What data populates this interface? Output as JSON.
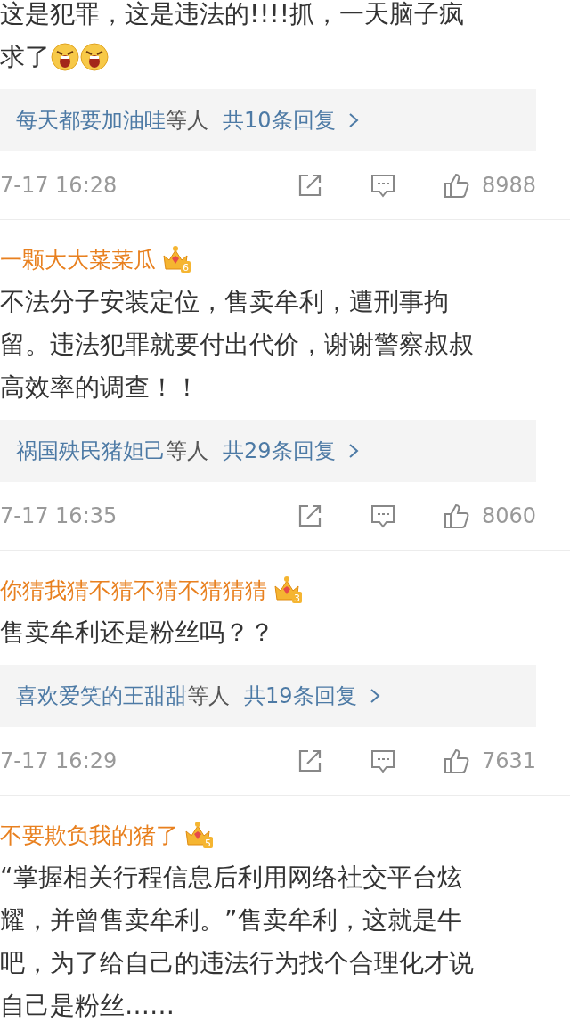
{
  "comments": [
    {
      "body_lines": [
        "这是犯罪，这是违法的!!!!抓，一天脑子疯",
        "求了"
      ],
      "emojis": [
        {
          "kind": "angry"
        },
        {
          "kind": "angry"
        }
      ],
      "reply_preview": {
        "names": "每天都要加油哇",
        "suffix": "等人",
        "count": "共10条回复"
      },
      "time": "7-17 16:28",
      "likes": "8988"
    },
    {
      "username": "一颗大大菜菜瓜",
      "badge_level": "6",
      "body_lines": [
        "不法分子安装定位，售卖牟利，遭刑事拘",
        "留。违法犯罪就要付出代价，谢谢警察叔叔",
        "高效率的调查！！"
      ],
      "reply_preview": {
        "names": "祸国殃民猪妲己",
        "suffix": "等人",
        "count": "共29条回复"
      },
      "time": "7-17 16:35",
      "likes": "8060"
    },
    {
      "username": "你猜我猜不猜不猜不猜猜猜",
      "badge_level": "3",
      "body_lines": [
        "售卖牟利还是粉丝吗？？"
      ],
      "reply_preview": {
        "names": "喜欢爱笑的王甜甜",
        "suffix": "等人",
        "count": "共19条回复"
      },
      "time": "7-17 16:29",
      "likes": "7631"
    },
    {
      "username": "不要欺负我的猪了",
      "badge_level": "5",
      "body_lines": [
        "“掌握相关行程信息后利用网络社交平台炫",
        "耀，并曾售卖牟利。”售卖牟利，这就是牛",
        "吧，为了给自己的违法行为找个合理化才说",
        "自己是粉丝……"
      ]
    }
  ]
}
